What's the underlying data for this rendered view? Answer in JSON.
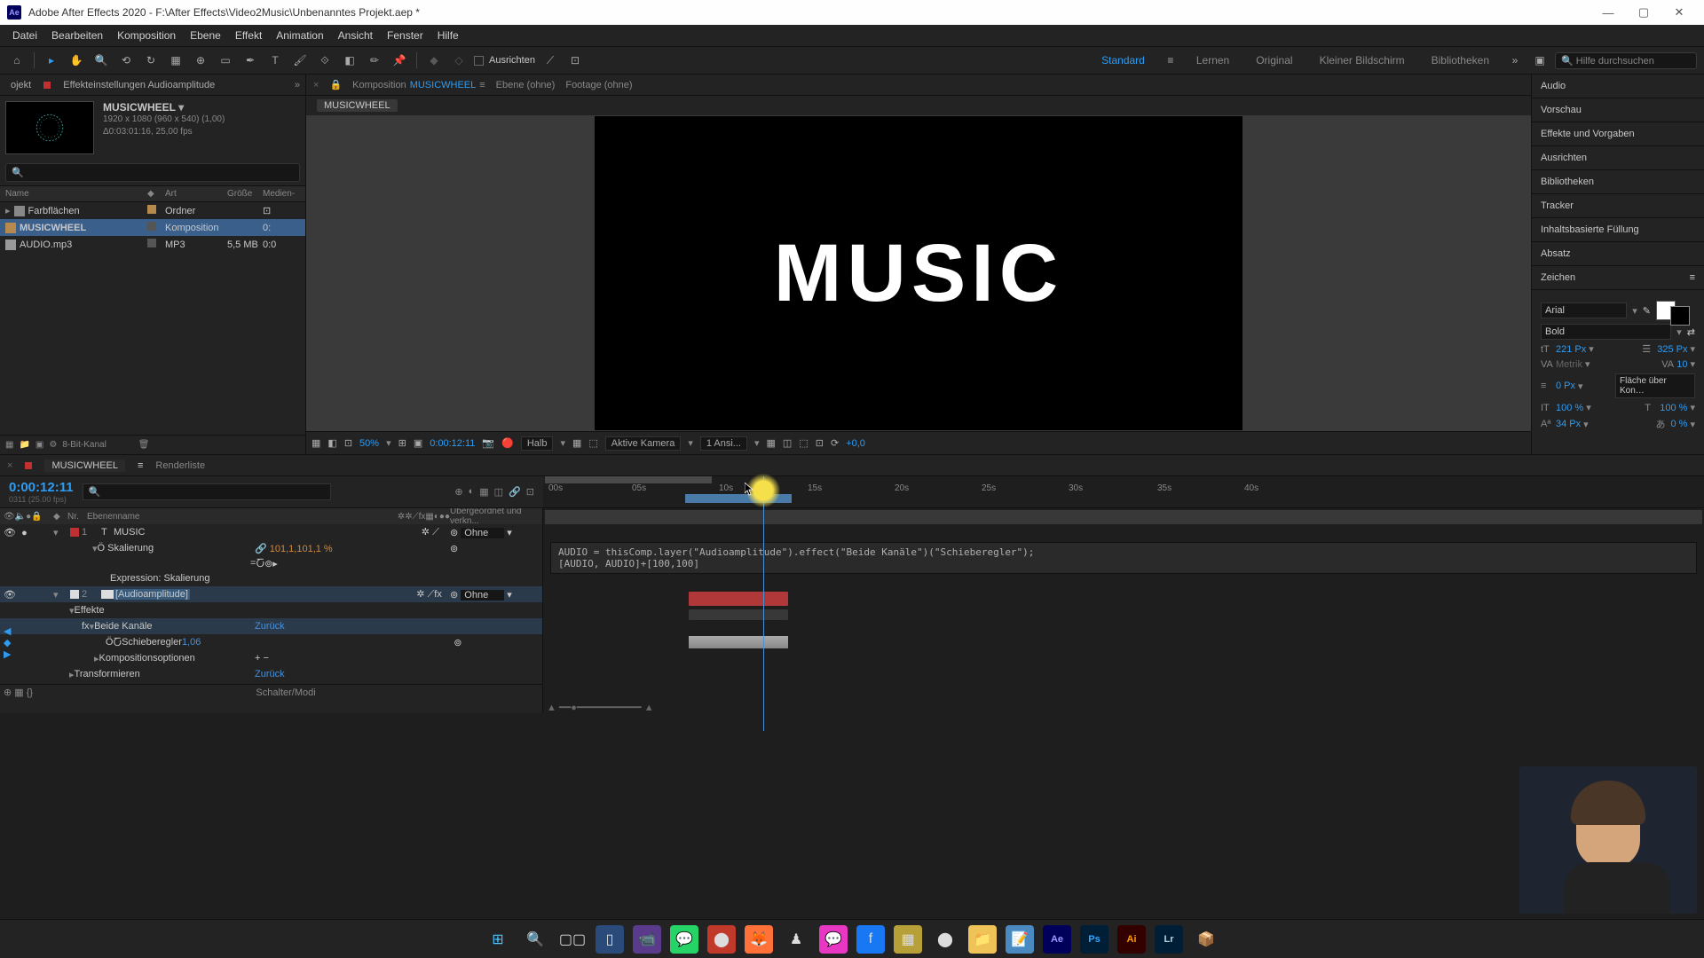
{
  "window": {
    "title": "Adobe After Effects 2020 - F:\\After Effects\\Video2Music\\Unbenanntes Projekt.aep *"
  },
  "menu": [
    "Datei",
    "Bearbeiten",
    "Komposition",
    "Ebene",
    "Effekt",
    "Animation",
    "Ansicht",
    "Fenster",
    "Hilfe"
  ],
  "toolbar": {
    "align_label": "Ausrichten",
    "workspaces": [
      "Standard",
      "Lernen",
      "Original",
      "Kleiner Bildschirm",
      "Bibliotheken"
    ],
    "search_placeholder": "Hilfe durchsuchen"
  },
  "project": {
    "tab1": "ojekt",
    "tab2": "Effekteinstellungen Audioamplitude",
    "comp_name": "MUSICWHEEL",
    "meta1": "1920 x 1080 (960 x 540) (1,00)",
    "meta2": "Δ0:03:01:16, 25,00 fps",
    "search_placeholder": "",
    "cols": {
      "name": "Name",
      "type": "Art",
      "size": "Größe",
      "media": "Medien-"
    },
    "items": [
      {
        "name": "Farbflächen",
        "type": "Ordner",
        "size": "",
        "media": "",
        "icon": "fold"
      },
      {
        "name": "MUSICWHEEL",
        "type": "Komposition",
        "size": "",
        "media": "0:",
        "icon": "comp",
        "sel": true
      },
      {
        "name": "AUDIO.mp3",
        "type": "MP3",
        "size": "5,5 MB",
        "media": "0:0",
        "icon": "audio"
      }
    ],
    "foot": "8-Bit-Kanal"
  },
  "comp": {
    "tabs": {
      "komposition": "Komposition",
      "name": "MUSICWHEEL",
      "ebene": "Ebene (ohne)",
      "footage": "Footage (ohne)"
    },
    "crumb": "MUSICWHEEL",
    "canvas_text": "MUSIC",
    "footer": {
      "zoom": "50%",
      "time": "0:00:12:11",
      "res": "Halb",
      "cam": "Aktive Kamera",
      "views": "1 Ansi...",
      "exp": "+0,0"
    }
  },
  "panels": [
    "Audio",
    "Vorschau",
    "Effekte und Vorgaben",
    "Ausrichten",
    "Bibliotheken",
    "Tracker",
    "Inhaltsbasierte Füllung",
    "Absatz",
    "Zeichen"
  ],
  "char": {
    "font": "Arial",
    "weight": "Bold",
    "size": "221 Px",
    "leading": "325 Px",
    "kern": "Metrik",
    "tracking": "10",
    "stroke": "0 Px",
    "fill_opt": "Fläche über Kon…",
    "hscale": "100 %",
    "vscale": "100 %",
    "baseline": "34 Px",
    "tsume": "0 %"
  },
  "timeline": {
    "tab": "MUSICWHEEL",
    "tab2": "Renderliste",
    "timecode": "0:00:12:11",
    "tc_sub": "0311 (25.00 fps)",
    "cols": {
      "nr": "Nr.",
      "name": "Ebenenname",
      "parent": "Übergeordnet und verkn..."
    },
    "layer1": {
      "num": "1",
      "name": "MUSIC",
      "parent": "Ohne",
      "prop": "Skalierung",
      "val": "101,1,101,1 %",
      "expr_label": "Expression: Skalierung"
    },
    "layer2": {
      "num": "2",
      "name": "[Audioamplitude]",
      "parent": "Ohne",
      "eff": "Effekte",
      "fx": "Beide Kanäle",
      "back": "Zurück",
      "slider": "Schieberegler",
      "slider_val": "1,06",
      "kopt": "Kompositionsoptionen",
      "trans": "Transformieren",
      "trans_back": "Zurück"
    },
    "expression": "AUDIO = thisComp.layer(\"Audioamplitude\").effect(\"Beide Kanäle\")(\"Schieberegler\");\n[AUDIO, AUDIO]+[100,100]",
    "ticks": [
      "00s",
      "05s",
      "10s",
      "15s",
      "20s",
      "25s",
      "30s",
      "35s",
      "40s"
    ],
    "foot": "Schalter/Modi"
  }
}
